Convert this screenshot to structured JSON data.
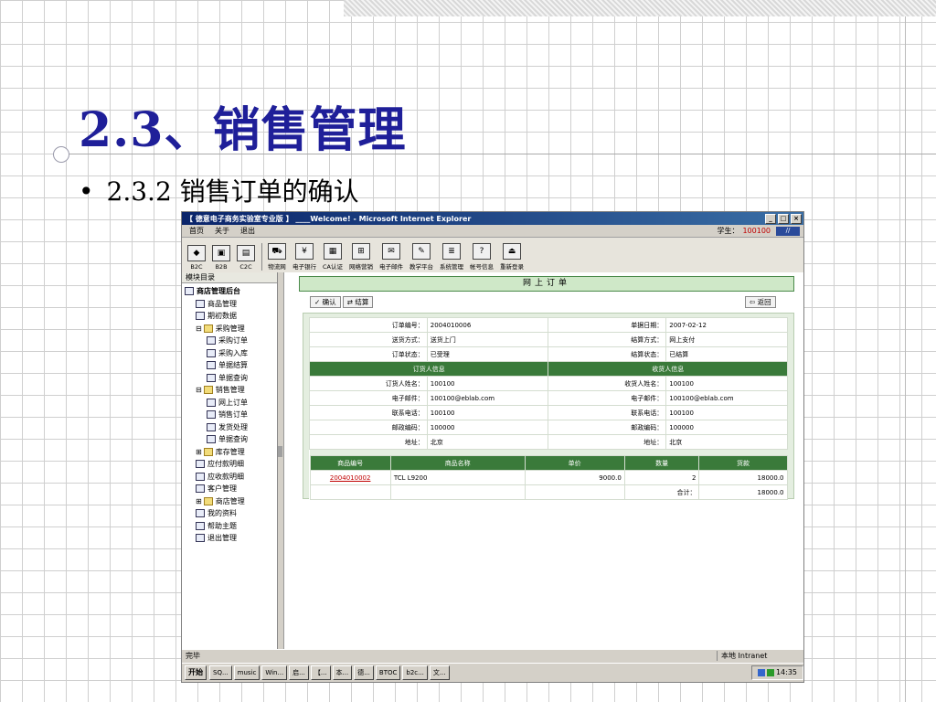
{
  "slide": {
    "title": "2.3、销售管理",
    "bullet": "2.3.2 销售订单的确认",
    "bullet_mark": "•"
  },
  "window": {
    "title": "【 德意电子商务实验室专业版 】 ____Welcome! - Microsoft Internet Explorer",
    "controls": [
      "_",
      "□",
      "×"
    ],
    "menu": [
      "首页",
      "关于",
      "退出"
    ],
    "student_label": "学生：",
    "student_id": "100100",
    "toolbar": [
      "B2C",
      "B2B",
      "C2C",
      "物流网",
      "电子银行",
      "CA认证",
      "网络营销",
      "电子邮件",
      "教学平台",
      "系统管理",
      "帐号信息",
      "重新登录"
    ]
  },
  "sidebar": {
    "header": "模块目录",
    "items": [
      {
        "label": "商店管理后台",
        "level": 0,
        "bold": true,
        "icon": "globe-icon"
      },
      {
        "label": "商品管理",
        "level": 1,
        "icon": "page-icon"
      },
      {
        "label": "期初数据",
        "level": 1,
        "icon": "page-icon"
      },
      {
        "label": "采购管理",
        "level": 1,
        "icon": "folder-open-icon",
        "prefix": "⊟"
      },
      {
        "label": "采购订单",
        "level": 2,
        "icon": "page-icon"
      },
      {
        "label": "采购入库",
        "level": 2,
        "icon": "page-icon"
      },
      {
        "label": "单据结算",
        "level": 2,
        "icon": "page-icon"
      },
      {
        "label": "单据查询",
        "level": 2,
        "icon": "page-icon"
      },
      {
        "label": "销售管理",
        "level": 1,
        "icon": "folder-open-icon",
        "prefix": "⊟"
      },
      {
        "label": "网上订单",
        "level": 2,
        "icon": "page-icon"
      },
      {
        "label": "销售订单",
        "level": 2,
        "icon": "page-icon"
      },
      {
        "label": "发货处理",
        "level": 2,
        "icon": "page-icon"
      },
      {
        "label": "单据查询",
        "level": 2,
        "icon": "page-icon"
      },
      {
        "label": "库存管理",
        "level": 1,
        "icon": "folder-icon",
        "prefix": "⊞"
      },
      {
        "label": "应付款明细",
        "level": 1,
        "icon": "page-icon"
      },
      {
        "label": "应收款明细",
        "level": 1,
        "icon": "page-icon"
      },
      {
        "label": "客户管理",
        "level": 1,
        "icon": "page-icon"
      },
      {
        "label": "商店管理",
        "level": 1,
        "icon": "folder-icon",
        "prefix": "⊞"
      },
      {
        "label": "我的资料",
        "level": 1,
        "icon": "page-icon"
      },
      {
        "label": "帮助主题",
        "level": 1,
        "icon": "help-icon"
      },
      {
        "label": "退出管理",
        "level": 1,
        "icon": "exit-icon"
      }
    ]
  },
  "main": {
    "heading": "网上订单",
    "confirm_button": "确认",
    "settle_button": "结算",
    "back_button": "返回",
    "order": {
      "rows": [
        [
          "订单编号：",
          "2004010006",
          "单据日期：",
          "2007-02-12"
        ],
        [
          "送货方式：",
          "送货上门",
          "结算方式：",
          "网上支付"
        ],
        [
          "订单状态：",
          "已受理",
          "结算状态：",
          "已结算"
        ]
      ],
      "group_headers": [
        "订货人信息",
        "收货人信息"
      ],
      "people": [
        [
          "订货人姓名：",
          "100100",
          "收货人姓名：",
          "100100"
        ],
        [
          "电子邮件：",
          "100100@eblab.com",
          "电子邮件：",
          "100100@eblab.com"
        ],
        [
          "联系电话：",
          "100100",
          "联系电话：",
          "100100"
        ],
        [
          "邮政编码：",
          "100000",
          "邮政编码：",
          "100000"
        ],
        [
          "地址：",
          "北京",
          "地址：",
          "北京"
        ]
      ],
      "item_headers": [
        "商品编号",
        "商品名称",
        "单价",
        "数量",
        "货款"
      ],
      "items": [
        {
          "code": "2004010002",
          "name": "TCL L9200",
          "price": "9000.0",
          "qty": "2",
          "amount": "18000.0"
        }
      ],
      "total_label": "合计：",
      "total_value": "18000.0"
    }
  },
  "status": {
    "left": "完毕",
    "zone": "本地 Intranet"
  },
  "taskbar": {
    "start": "开始",
    "tasks": [
      "SQ...",
      "music",
      "Win...",
      "启...",
      "【...",
      "本...",
      "德...",
      "BTOC",
      "b2c...",
      "文..."
    ],
    "clock": "14:35"
  },
  "colors": {
    "title": "#1f1f99",
    "green_header": "#3a7a3a",
    "link": "#c00000",
    "titlebar": "#0a246a"
  }
}
